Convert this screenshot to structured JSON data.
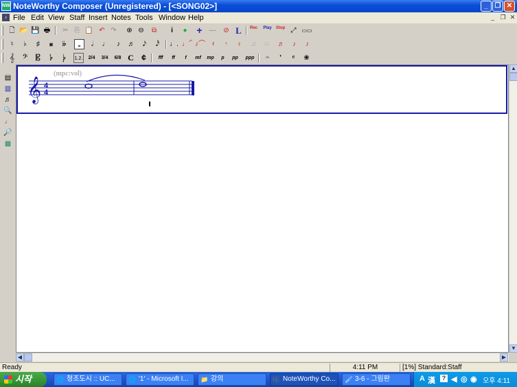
{
  "window": {
    "title": "NoteWorthy Composer (Unregistered) - [<SONG02>]",
    "app_icon": "NW",
    "buttons": [
      "_",
      "❐",
      "✕"
    ]
  },
  "menu": {
    "items": [
      "File",
      "Edit",
      "View",
      "Staff",
      "Insert",
      "Notes",
      "Tools",
      "Window",
      "Help"
    ],
    "mdi_buttons": [
      "_",
      "❐",
      "✕"
    ]
  },
  "toolbar1": {
    "buttons": [
      "🗋",
      "📂",
      "💾",
      "🖶",
      "✂",
      "⎘",
      "📋",
      "↶",
      "↷",
      "⊕",
      "⊖",
      "⧉",
      "i",
      "●",
      "+",
      "—",
      "⊘",
      "L",
      "Rec",
      "Play",
      "Stop",
      "⤢",
      "▭▭"
    ]
  },
  "toolbar2": {
    "buttons": [
      "♮",
      "♭",
      "♯",
      "𝄪",
      "𝄫",
      "𝅝",
      "𝅗𝅥",
      "♩",
      "♪",
      "♬",
      "𝅘𝅥𝅯",
      "𝅘𝅥𝅰",
      "♩.",
      "♩⌒",
      "♪⌒",
      "𝄽",
      "𝄾",
      "𝄿",
      "♫",
      "𝅘𝅥𝅮𝅘𝅥𝅮",
      "♬",
      "♪",
      "♪"
    ]
  },
  "toolbar3": {
    "buttons": [
      "𝄞",
      "𝄢",
      "𝄡",
      "𝄬",
      "𝄭",
      "1.2.",
      "2/4",
      "3/4",
      "6/8",
      "C",
      "¢",
      "fff",
      "ff",
      "f",
      "mf",
      "mp",
      "p",
      "pp",
      "ppp",
      "𝄐",
      "’",
      "𝄴",
      "❀"
    ]
  },
  "left_toolbar": {
    "buttons": [
      "▤",
      "▥",
      "♬",
      "🔍",
      "♩",
      "🔎",
      "▦"
    ]
  },
  "score": {
    "annotation": "(mpc:vol)",
    "time_signature_top": "4",
    "time_signature_bottom": "4"
  },
  "status": {
    "ready": "Ready",
    "time": "4:11 PM",
    "staff": "[1%] Standard:Staff"
  },
  "taskbar": {
    "start": "시작",
    "tasks": [
      {
        "label": "청조도시 :: UC...",
        "icon": "🌐"
      },
      {
        "label": "'1' - Microsoft I...",
        "icon": "🌐"
      },
      {
        "label": "강의",
        "icon": "📁"
      },
      {
        "label": "NoteWorthy Co...",
        "icon": "🎼",
        "active": true
      },
      {
        "label": "3-6 - 그림판",
        "icon": "🖌"
      }
    ],
    "tray_icons": [
      "A",
      "漢",
      "?",
      "◀",
      "◎",
      "◉"
    ],
    "clock": "오후 4:11"
  },
  "colors": {
    "staff_blue": "#1818a8",
    "titlebar": "#0a4fd8",
    "taskbar": "#245edb"
  }
}
